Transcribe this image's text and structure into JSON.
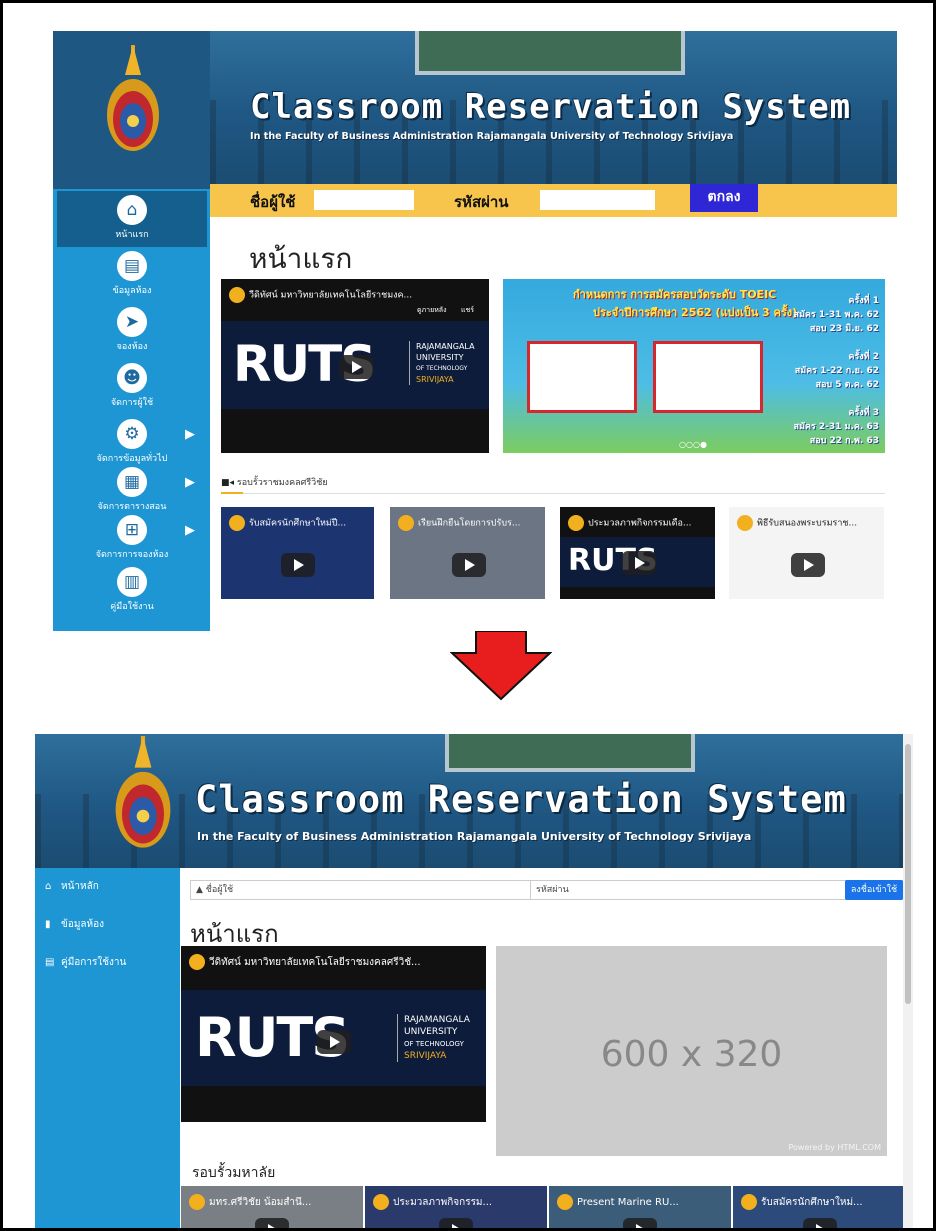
{
  "old_ui": {
    "banner": {
      "title": "Classroom Reservation System",
      "subtitle": "In the Faculty of Business Administration Rajamangala University of Technology Srivijaya"
    },
    "nav": [
      {
        "label": "หน้าแรก",
        "icon": "home-icon"
      },
      {
        "label": "ข้อมูลห้อง",
        "icon": "documents-icon"
      },
      {
        "label": "จองห้อง",
        "icon": "cursor-icon"
      },
      {
        "label": "จัดการผู้ใช้",
        "icon": "user-gear-icon"
      },
      {
        "label": "จัดการข้อมูลทั่วไป",
        "icon": "gears-icon"
      },
      {
        "label": "จัดการตารางสอน",
        "icon": "schedule-icon"
      },
      {
        "label": "จัดการการจองห้อง",
        "icon": "sitemap-icon"
      },
      {
        "label": "คู่มือใช้งาน",
        "icon": "book-icon"
      }
    ],
    "login": {
      "username_label": "ชื่อผู้ใช้",
      "password_label": "รหัสผ่าน",
      "submit_label": "ตกลง"
    },
    "page_title": "หน้าแรก",
    "main_video": {
      "caption": "วีดิทัศน์ มหาวิทยาลัยเทคโนโลยีราชมงค...",
      "watch_later": "ดูภายหลัง",
      "share": "แชร์",
      "brand": "RUTS",
      "uni_lines": [
        "RAJAMANGALA",
        "UNIVERSITY",
        "OF TECHNOLOGY",
        "SRIVIJAYA"
      ]
    },
    "toeic": {
      "headline1": "กำหนดการ การสมัครสอบวัดระดับ TOEIC",
      "headline2": "ประจำปีการศึกษา 2562 (แบ่งเป็น 3 ครั้ง)",
      "rounds": [
        {
          "title": "ครั้งที่ 1",
          "line1": "สมัคร 1-31 พ.ค. 62",
          "line2": "สอบ 23 มิ.ย. 62"
        },
        {
          "title": "ครั้งที่ 2",
          "line1": "สมัคร 1-22 ก.ย. 62",
          "line2": "สอบ 5 ต.ค. 62"
        },
        {
          "title": "ครั้งที่ 3",
          "line1": "สมัคร 2-31 ม.ค. 63",
          "line2": "สอบ 22 ก.พ. 63"
        }
      ]
    },
    "news_heading": "รอบรั้วราชมงคลศรีวิชัย",
    "news_videos": [
      {
        "caption": "รับสมัครนักศึกษาใหม่ปี..."
      },
      {
        "caption": "เรียนฝึกยืนโดยการปรับร..."
      },
      {
        "caption": "ประมวลภาพกิจกรรมเดือ..."
      },
      {
        "caption": "พิธีรับสนองพระบรมราช..."
      }
    ]
  },
  "new_ui": {
    "banner": {
      "title": "Classroom Reservation System",
      "subtitle": "In the Faculty of Business Administration Rajamangala University of Technology Srivijaya"
    },
    "nav": [
      {
        "label": "หน้าหลัก",
        "icon": "home-icon"
      },
      {
        "label": "ข้อมูลห้อง",
        "icon": "file-icon"
      },
      {
        "label": "คู่มือการใช้งาน",
        "icon": "document-icon"
      }
    ],
    "login": {
      "username_placeholder": "ชื่อผู้ใช้",
      "password_placeholder": "รหัสผ่าน",
      "submit_label": "ลงชื่อเข้าใช้"
    },
    "page_title": "หน้าแรก",
    "main_video": {
      "caption": "วีดิทัศน์ มหาวิทยาลัยเทคโนโลยีราชมงคลศรีวิชั...",
      "brand": "RUTS",
      "uni_lines": [
        "RAJAMANGALA",
        "UNIVERSITY",
        "OF TECHNOLOGY",
        "SRIVIJAYA"
      ]
    },
    "placeholder": {
      "text": "600 x 320",
      "powered": "Powered by HTML.COM"
    },
    "news_heading": "รอบรั้วมหาลัย",
    "news_videos": [
      {
        "caption": "มทร.ศรีวิชัย น้อมสำนึ..."
      },
      {
        "caption": "ประมวลภาพกิจกรรม..."
      },
      {
        "caption": "Present Marine RU..."
      },
      {
        "caption": "รับสมัครนักศึกษาใหม่..."
      }
    ]
  },
  "colors": {
    "sidebar": "#1e96d3",
    "login_bar_old": "#f7c54c",
    "submit_old": "#2f27d6",
    "submit_new": "#1a73e8",
    "arrow": "#e81e1e"
  }
}
